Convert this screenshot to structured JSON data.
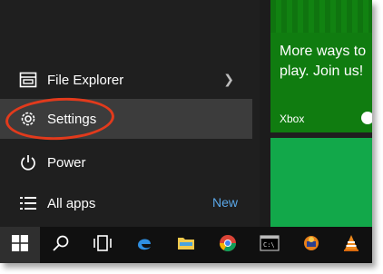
{
  "start_menu": {
    "items": [
      {
        "label": "File Explorer",
        "icon": "file-explorer-icon"
      },
      {
        "label": "Settings",
        "icon": "gear-icon"
      },
      {
        "label": "Power",
        "icon": "power-icon"
      },
      {
        "label": "All apps",
        "icon": "list-icon"
      }
    ],
    "new_badge": "New"
  },
  "tiles": {
    "xbox": {
      "text": "More ways to play. Join us!",
      "label": "Xbox",
      "color": "#107c10"
    },
    "green_tile_color": "#12a84a"
  },
  "taskbar": {
    "buttons": [
      "windows-start-icon",
      "search-icon",
      "task-view-icon",
      "edge-icon",
      "file-explorer-icon",
      "chrome-icon",
      "command-prompt-icon",
      "app-icon",
      "vlc-icon"
    ]
  },
  "annotation": {
    "color": "#e23a1c"
  }
}
